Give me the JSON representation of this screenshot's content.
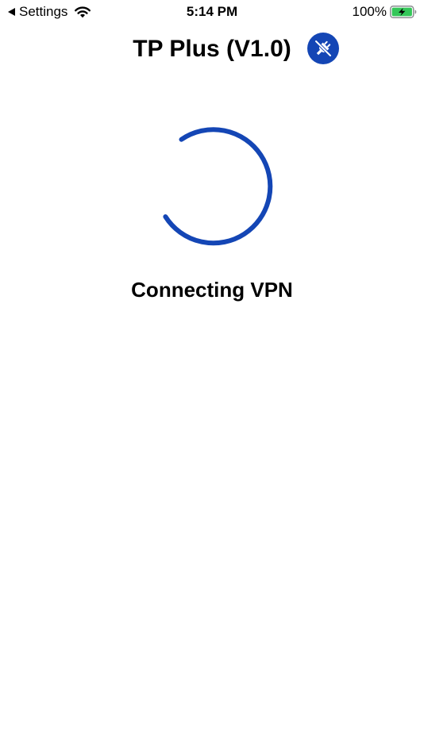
{
  "status_bar": {
    "back_label": "Settings",
    "time": "5:14 PM",
    "battery_percent": "100%",
    "icons": [
      "back-arrow-icon",
      "wifi-icon",
      "battery-charging-icon"
    ]
  },
  "header": {
    "title": "TP Plus (V1.0)",
    "status_icon": "disconnected-plug-icon"
  },
  "main": {
    "status_message": "Connecting VPN",
    "spinner_icon": "loading-spinner-icon"
  },
  "colors": {
    "accent": "#1446b5",
    "battery_fill": "#34c759",
    "text": "#000000",
    "background": "#ffffff"
  }
}
